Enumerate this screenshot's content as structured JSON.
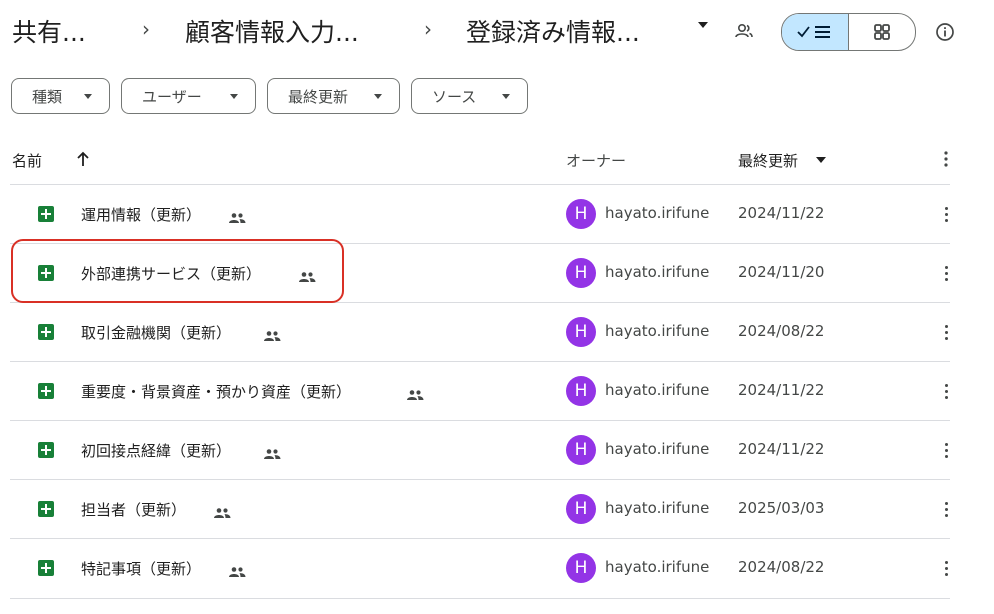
{
  "breadcrumb": {
    "items": [
      "共有...",
      "顧客情報入力...",
      "登録済み情報..."
    ],
    "separator": "›"
  },
  "filters": [
    {
      "label": "種類"
    },
    {
      "label": "ユーザー"
    },
    {
      "label": "最終更新"
    },
    {
      "label": "ソース"
    }
  ],
  "columns": {
    "name": "名前",
    "owner": "オーナー",
    "modified": "最終更新"
  },
  "files": [
    {
      "name": "運用情報（更新）",
      "owner_initial": "H",
      "owner": "hayato.irifune",
      "modified": "2024/11/22"
    },
    {
      "name": "外部連携サービス（更新）",
      "owner_initial": "H",
      "owner": "hayato.irifune",
      "modified": "2024/11/20"
    },
    {
      "name": "取引金融機関（更新）",
      "owner_initial": "H",
      "owner": "hayato.irifune",
      "modified": "2024/08/22"
    },
    {
      "name": "重要度・背景資産・預かり資産（更新）",
      "owner_initial": "H",
      "owner": "hayato.irifune",
      "modified": "2024/11/22"
    },
    {
      "name": "初回接点経緯（更新）",
      "owner_initial": "H",
      "owner": "hayato.irifune",
      "modified": "2024/11/22"
    },
    {
      "name": "担当者（更新）",
      "owner_initial": "H",
      "owner": "hayato.irifune",
      "modified": "2025/03/03"
    },
    {
      "name": "特記事項（更新）",
      "owner_initial": "H",
      "owner": "hayato.irifune",
      "modified": "2024/08/22"
    }
  ],
  "icons": {
    "file": "google-sheets-icon",
    "shared": "shared-people-icon",
    "more": "more-vert-icon",
    "info": "info-icon",
    "manage_access": "manage-access-icon",
    "list_view": "list-view-icon",
    "grid_view": "grid-view-icon"
  },
  "colors": {
    "sheets_green": "#188038",
    "avatar_purple": "#9334e6",
    "selected_toggle": "#c2e7ff",
    "highlight_red": "#d93025"
  }
}
